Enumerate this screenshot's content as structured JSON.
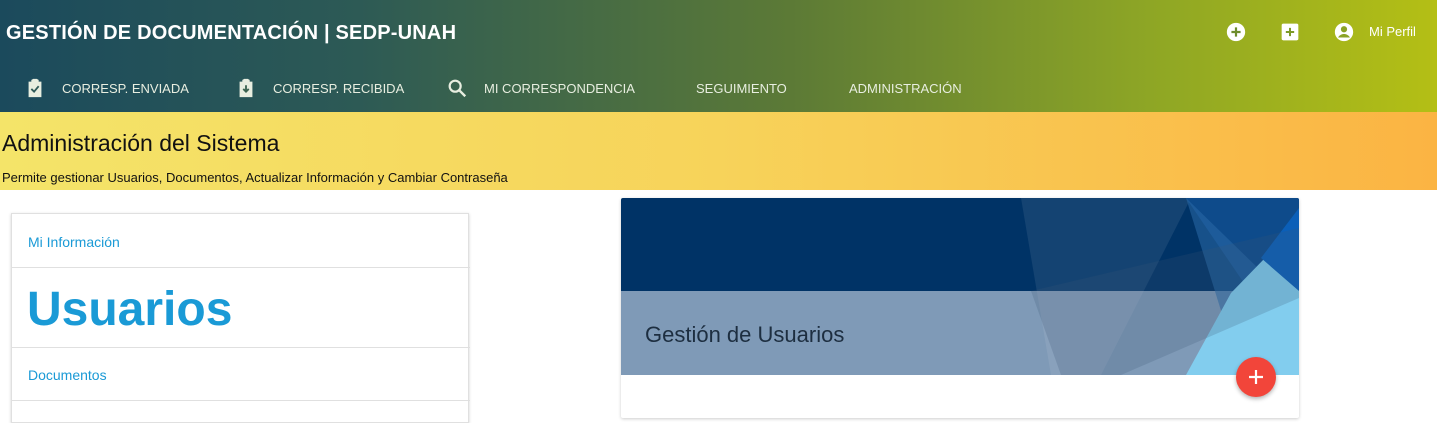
{
  "header": {
    "title": "GESTIÓN DE DOCUMENTACIÓN | SEDP-UNAH",
    "actions": {
      "add_circle_icon": "add-circle-icon",
      "add_box_icon": "add-box-icon",
      "profile_icon": "account-circle-icon",
      "profile_label": "Mi Perfil"
    }
  },
  "nav": {
    "items": [
      {
        "label": "CORRESP. ENVIADA",
        "icon": "clipboard-check-icon"
      },
      {
        "label": "CORRESP. RECIBIDA",
        "icon": "clipboard-download-icon"
      },
      {
        "label": "MI CORRESPONDENCIA",
        "icon": "search-icon"
      },
      {
        "label": "SEGUIMIENTO"
      },
      {
        "label": "ADMINISTRACIÓN"
      }
    ]
  },
  "banner": {
    "title": "Administración del Sistema",
    "subtitle": "Permite gestionar Usuarios, Documentos, Actualizar Información y Cambiar Contraseña"
  },
  "sidebar": {
    "items": [
      {
        "label": "Mi Información"
      },
      {
        "label": "Usuarios"
      },
      {
        "label": "Documentos"
      }
    ]
  },
  "card": {
    "title": "Gestión de Usuarios",
    "fab_icon": "plus-icon"
  },
  "colors": {
    "header_start": "#1b4a5c",
    "header_end": "#b4bf15",
    "banner_start": "#f4e469",
    "banner_end": "#fbb443",
    "link": "#1a9ad6",
    "fab": "#f2453a",
    "card_dark": "#003366",
    "card_band": "#7f9ab7"
  }
}
